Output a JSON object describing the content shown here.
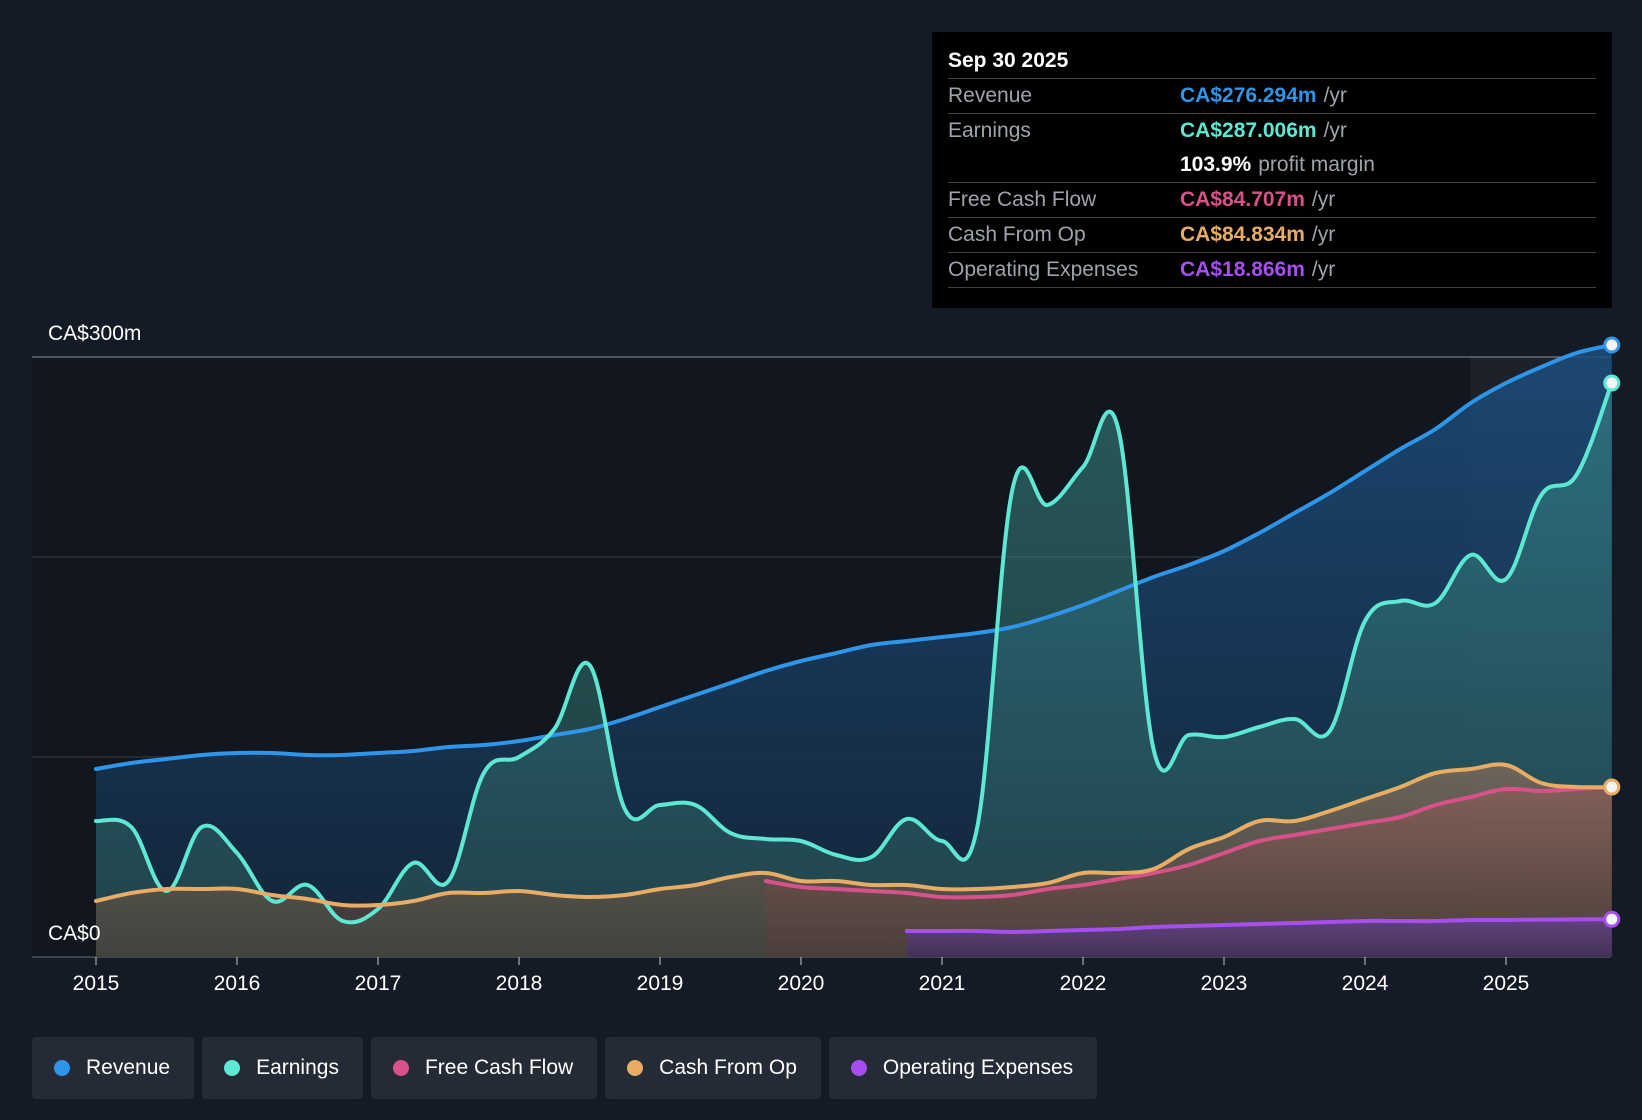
{
  "tooltip": {
    "date": "Sep 30 2025",
    "rows": [
      {
        "label": "Revenue",
        "value": "CA$276.294m",
        "unit": "/yr",
        "color": "#2f95e8"
      },
      {
        "label": "Earnings",
        "value": "CA$287.006m",
        "unit": "/yr",
        "color": "#5ee8d4"
      },
      {
        "label": "",
        "value": "103.9%",
        "unit": "profit margin",
        "color": "#ffffff"
      },
      {
        "label": "Free Cash Flow",
        "value": "CA$84.707m",
        "unit": "/yr",
        "color": "#d9518a"
      },
      {
        "label": "Cash From Op",
        "value": "CA$84.834m",
        "unit": "/yr",
        "color": "#e8ac64"
      },
      {
        "label": "Operating Expenses",
        "value": "CA$18.866m",
        "unit": "/yr",
        "color": "#a64ef0"
      }
    ]
  },
  "legend": [
    {
      "label": "Revenue",
      "color": "#2f95e8"
    },
    {
      "label": "Earnings",
      "color": "#5ee8d4"
    },
    {
      "label": "Free Cash Flow",
      "color": "#d9518a"
    },
    {
      "label": "Cash From Op",
      "color": "#e8ac64"
    },
    {
      "label": "Operating Expenses",
      "color": "#a64ef0"
    }
  ],
  "chart_data": {
    "type": "area",
    "y_top_label": "CA$300m",
    "y_bottom_label": "CA$0",
    "ylim": [
      0,
      300
    ],
    "xlim": [
      2015,
      2025.75
    ],
    "x_ticks": [
      "2015",
      "2016",
      "2017",
      "2018",
      "2019",
      "2020",
      "2021",
      "2022",
      "2023",
      "2024",
      "2025"
    ],
    "forecast_start": 2024.75,
    "grid": true,
    "legend_position": "bottom",
    "series": [
      {
        "name": "Revenue",
        "color": "#2f95e8",
        "x": [
          2015,
          2015.25,
          2015.5,
          2015.75,
          2016,
          2016.25,
          2016.5,
          2016.75,
          2017,
          2017.25,
          2017.5,
          2017.75,
          2018,
          2018.25,
          2018.5,
          2018.75,
          2019,
          2019.25,
          2019.5,
          2019.75,
          2020,
          2020.25,
          2020.5,
          2020.75,
          2021,
          2021.25,
          2021.5,
          2021.75,
          2022,
          2022.25,
          2022.5,
          2022.75,
          2023,
          2023.25,
          2023.5,
          2023.75,
          2024,
          2024.25,
          2024.5,
          2024.75,
          2025,
          2025.25,
          2025.5,
          2025.75
        ],
        "y": [
          94,
          97,
          99,
          101,
          102,
          102,
          101,
          101,
          102,
          103,
          105,
          106,
          108,
          111,
          114,
          119,
          125,
          131,
          137,
          143,
          148,
          152,
          156,
          158,
          160,
          162,
          165,
          170,
          176,
          183,
          190,
          196,
          203,
          212,
          222,
          232,
          243,
          254,
          264,
          277,
          287,
          295,
          302,
          306
        ]
      },
      {
        "name": "Earnings",
        "color": "#5ee8d4",
        "x": [
          2015,
          2015.25,
          2015.5,
          2015.75,
          2016,
          2016.25,
          2016.5,
          2016.75,
          2017,
          2017.25,
          2017.5,
          2017.75,
          2018,
          2018.25,
          2018.5,
          2018.75,
          2019,
          2019.25,
          2019.5,
          2019.75,
          2020,
          2020.25,
          2020.5,
          2020.75,
          2021,
          2021.25,
          2021.5,
          2021.75,
          2022,
          2022.25,
          2022.5,
          2022.75,
          2023,
          2023.25,
          2023.5,
          2023.75,
          2024,
          2024.25,
          2024.5,
          2024.75,
          2025,
          2025.25,
          2025.5,
          2025.75
        ],
        "y": [
          68,
          65,
          33,
          65,
          52,
          28,
          36,
          18,
          24,
          47,
          38,
          92,
          100,
          114,
          146,
          74,
          76,
          76,
          62,
          59,
          58,
          51,
          50,
          69,
          58,
          65,
          234,
          226,
          245,
          264,
          104,
          111,
          110,
          115,
          119,
          113,
          168,
          178,
          177,
          201,
          189,
          231,
          241,
          287
        ]
      },
      {
        "name": "Free Cash Flow",
        "color": "#d9518a",
        "x": [
          2019.75,
          2020,
          2020.25,
          2020.5,
          2020.75,
          2021,
          2021.25,
          2021.5,
          2021.75,
          2022,
          2022.25,
          2022.5,
          2022.75,
          2023,
          2023.25,
          2023.5,
          2023.75,
          2024,
          2024.25,
          2024.5,
          2024.75,
          2025,
          2025.25,
          2025.5,
          2025.75
        ],
        "y": [
          38,
          35,
          34,
          33,
          32,
          30,
          30,
          31,
          34,
          36,
          39,
          42,
          46,
          52,
          58,
          61,
          64,
          67,
          70,
          76,
          80,
          84,
          83,
          84,
          85
        ]
      },
      {
        "name": "Cash From Op",
        "color": "#e8ac64",
        "x": [
          2015,
          2015.25,
          2015.5,
          2015.75,
          2016,
          2016.25,
          2016.5,
          2016.75,
          2017,
          2017.25,
          2017.5,
          2017.75,
          2018,
          2018.25,
          2018.5,
          2018.75,
          2019,
          2019.25,
          2019.5,
          2019.75,
          2020,
          2020.25,
          2020.5,
          2020.75,
          2021,
          2021.25,
          2021.5,
          2021.75,
          2022,
          2022.25,
          2022.5,
          2022.75,
          2023,
          2023.25,
          2023.5,
          2023.75,
          2024,
          2024.25,
          2024.5,
          2024.75,
          2025,
          2025.25,
          2025.5,
          2025.75
        ],
        "y": [
          28,
          32,
          34,
          34,
          34,
          31,
          29,
          26,
          26,
          28,
          32,
          32,
          33,
          31,
          30,
          31,
          34,
          36,
          40,
          42,
          38,
          38,
          36,
          36,
          34,
          34,
          35,
          37,
          42,
          42,
          44,
          54,
          60,
          68,
          68,
          73,
          79,
          85,
          92,
          94,
          96,
          87,
          85,
          85
        ]
      },
      {
        "name": "Operating Expenses",
        "color": "#a64ef0",
        "x": [
          2020.75,
          2021,
          2021.25,
          2021.5,
          2021.75,
          2022,
          2022.25,
          2022.5,
          2022.75,
          2023,
          2023.25,
          2023.5,
          2023.75,
          2024,
          2024.25,
          2024.5,
          2024.75,
          2025,
          2025.25,
          2025.5,
          2025.75
        ],
        "y": [
          13,
          13,
          13,
          12.5,
          13,
          13.5,
          14,
          15,
          15.5,
          16,
          16.5,
          17,
          17.5,
          18,
          18,
          18,
          18.5,
          18.5,
          18.7,
          18.8,
          18.9
        ]
      }
    ]
  }
}
